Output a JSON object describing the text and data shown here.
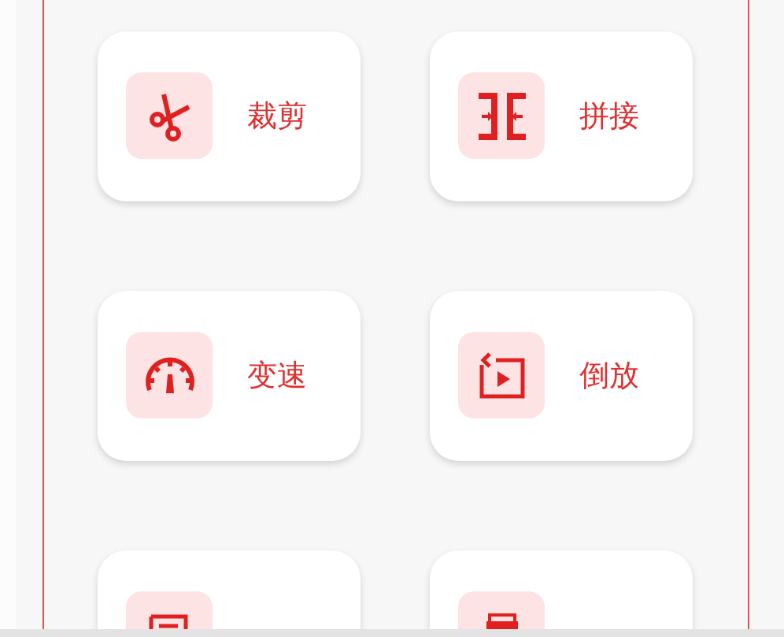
{
  "tools": [
    {
      "kind": "crop",
      "label": "裁剪"
    },
    {
      "kind": "join",
      "label": "拼接"
    },
    {
      "kind": "speed",
      "label": "变速"
    },
    {
      "kind": "reverse",
      "label": "倒放"
    },
    {
      "kind": "watermark"
    },
    {
      "kind": "gif"
    }
  ]
}
